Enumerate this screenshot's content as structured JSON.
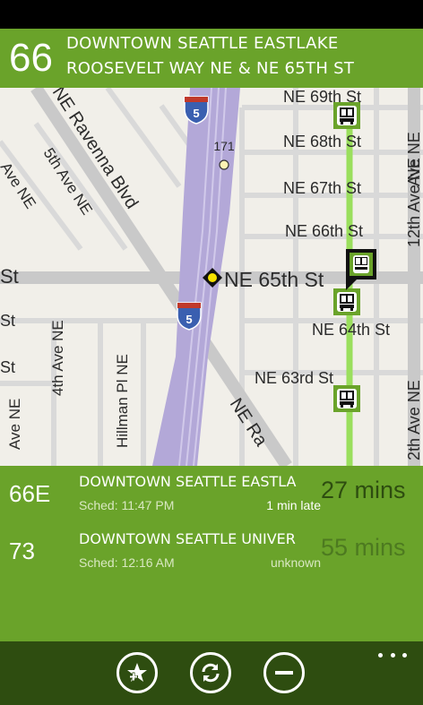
{
  "header": {
    "route_number": "66",
    "destination": "DOWNTOWN SEATTLE EASTLAKE",
    "stop": "ROOSEVELT WAY NE & NE 65TH ST"
  },
  "map": {
    "streets": {
      "ne_69th": "NE 69th St",
      "ne_68th": "NE 68th St",
      "ne_67th": "NE 67th St",
      "ne_66th": "NE 66th St",
      "ne_65th": "NE 65th St",
      "ne_65th_left": "St",
      "ne_64th": "NE 64th St",
      "ne_63rd": "NE 63rd St",
      "ravenna": "NE Ravenna Blvd",
      "fifth_ave": "5th Ave NE",
      "fourth_ave": "4th Ave NE",
      "hillman": "Hillman Pl NE",
      "ne_ra": "NE Ra",
      "ave_ne_left_top": "Ave NE",
      "ave_ne_left_bottom": "Ave NE",
      "st_left_1": "St",
      "st_left_2": "St",
      "twelfth_ave": "12th Ave NE",
      "right_ave_top": "Ave NE",
      "right_ave_bottom": "2th Ave NE"
    },
    "shields": {
      "interstate_top": "5",
      "interstate_bottom": "5",
      "route_171": "171"
    },
    "colors": {
      "background": "#f1efe9",
      "road": "#d6d6d6",
      "freeway": "#b3a8d8",
      "route_line": "#9adf5d",
      "accent": "#6aa32a"
    }
  },
  "arrivals": [
    {
      "route": "66E",
      "destination": "DOWNTOWN SEATTLE EASTLA",
      "scheduled": "Sched: 11:47 PM",
      "status": "1 min late",
      "minutes": "27 mins",
      "minutes_color": "#2e4d10"
    },
    {
      "route": "73",
      "destination": "DOWNTOWN SEATTLE UNIVER",
      "scheduled": "Sched: 12:16 AM",
      "status": "unknown",
      "minutes": "55 mins",
      "minutes_color": "#4d7a20"
    }
  ],
  "appbar": {
    "buttons": [
      "favorite-add-icon",
      "refresh-icon",
      "remove-icon"
    ],
    "more": "more-dots-icon"
  }
}
